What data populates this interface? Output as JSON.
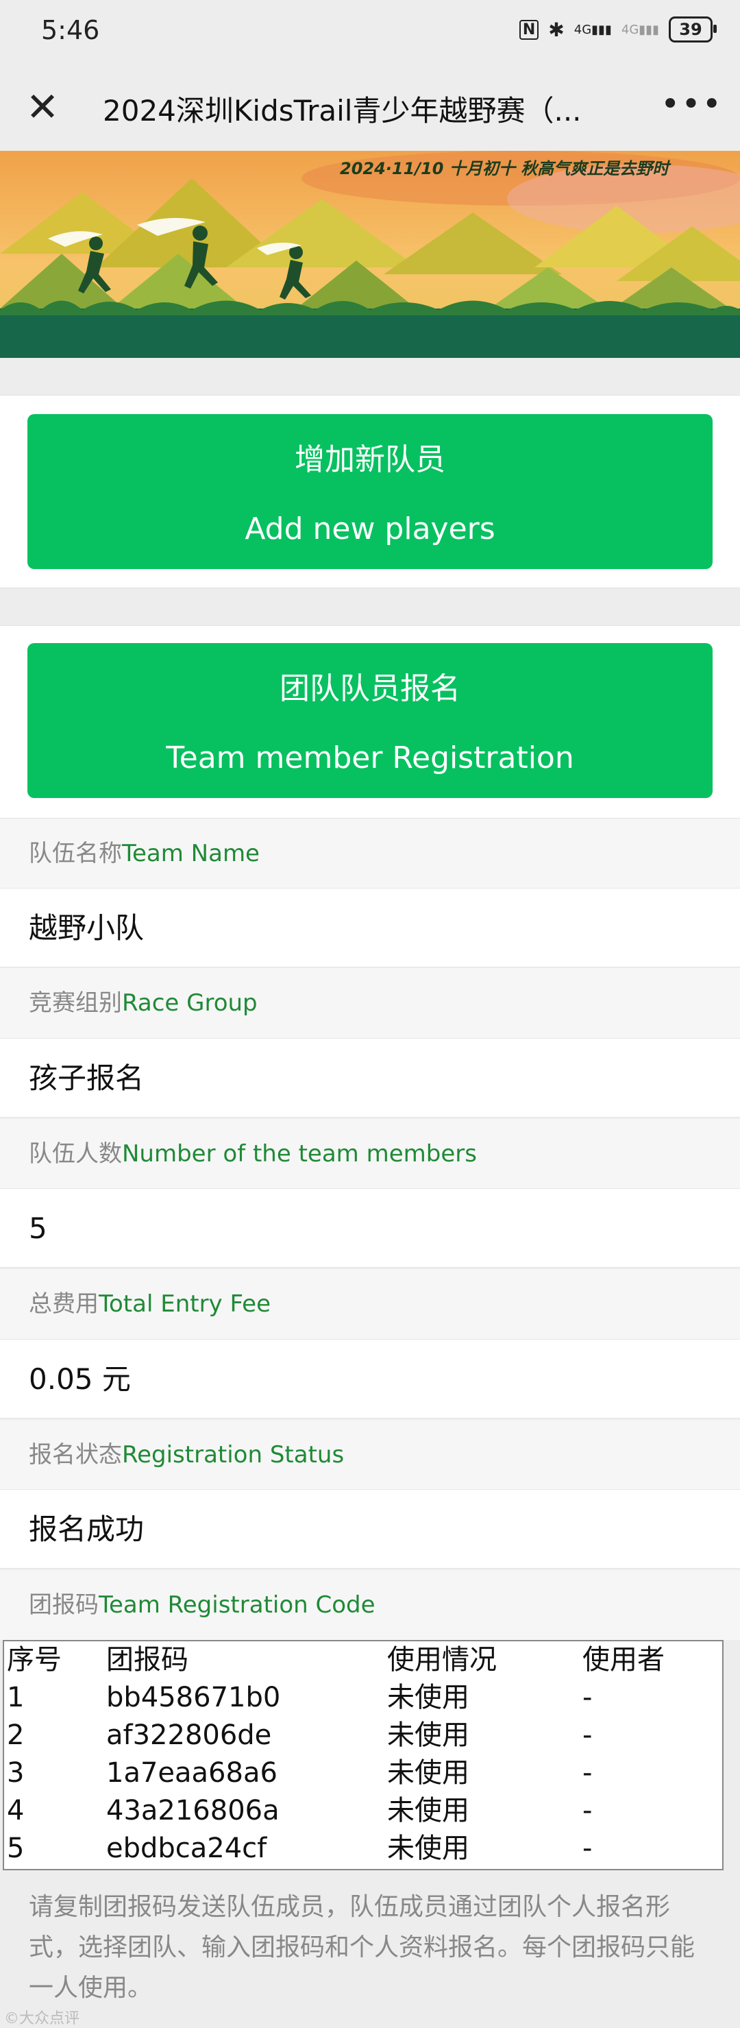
{
  "status_bar": {
    "time": "5:46",
    "nfc": "N",
    "bluetooth": "✱",
    "signal1": "4G",
    "signal2": "4G",
    "battery": "39"
  },
  "nav": {
    "close_icon": "close-icon",
    "title": "2024深圳KidsTrail青少年越野赛（...",
    "more_icon": "more-icon"
  },
  "banner": {
    "caption": "2024·11/10   十月初十   秋高气爽正是去野时"
  },
  "buttons": {
    "add_players_cn": "增加新队员",
    "add_players_en": "Add new players",
    "team_reg_cn": "团队队员报名",
    "team_reg_en": "Team member Registration"
  },
  "fields": [
    {
      "label_cn": "队伍名称",
      "label_en": "Team Name",
      "value": "越野小队"
    },
    {
      "label_cn": "竞赛组别",
      "label_en": "Race Group",
      "value": "孩子报名"
    },
    {
      "label_cn": "队伍人数",
      "label_en": "Number of the team members",
      "value": "5"
    },
    {
      "label_cn": "总费用",
      "label_en": "Total Entry Fee",
      "value": "0.05 元"
    },
    {
      "label_cn": "报名状态",
      "label_en": "Registration Status",
      "value": "报名成功"
    }
  ],
  "codes": {
    "label_cn": "团报码",
    "label_en": "Team Registration Code",
    "headers": [
      "序号",
      "团报码",
      "使用情况",
      "使用者"
    ],
    "rows": [
      [
        "1",
        "bb458671b0",
        "未使用",
        "-"
      ],
      [
        "2",
        "af322806de",
        "未使用",
        "-"
      ],
      [
        "3",
        "1a7eaa68a6",
        "未使用",
        "-"
      ],
      [
        "4",
        "43a216806a",
        "未使用",
        "-"
      ],
      [
        "5",
        "ebdbca24cf",
        "未使用",
        "-"
      ]
    ]
  },
  "note": "请复制团报码发送队伍成员，队伍成员通过团队个人报名形式，选择团队、输入团报码和个人资料报名。每个团报码只能一人使用。",
  "watermark": "©大众点评",
  "colors": {
    "accent_green": "#07c160",
    "label_green": "#1f8a36"
  }
}
